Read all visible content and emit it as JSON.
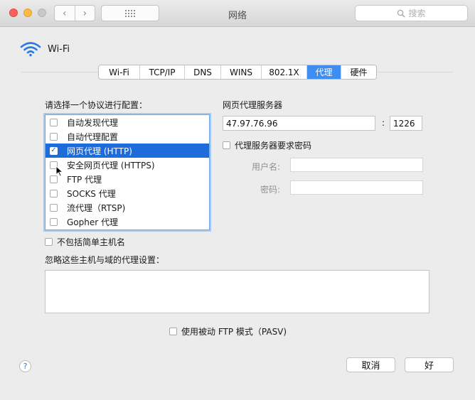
{
  "window": {
    "title": "网络"
  },
  "toolbar": {
    "search_placeholder": "搜索",
    "back": "‹",
    "forward": "›"
  },
  "interface": {
    "name": "Wi-Fi"
  },
  "tabs": [
    {
      "label": "Wi-Fi",
      "active": false
    },
    {
      "label": "TCP/IP",
      "active": false
    },
    {
      "label": "DNS",
      "active": false
    },
    {
      "label": "WINS",
      "active": false
    },
    {
      "label": "802.1X",
      "active": false
    },
    {
      "label": "代理",
      "active": true
    },
    {
      "label": "硬件",
      "active": false
    }
  ],
  "protocols": {
    "heading": "请选择一个协议进行配置：",
    "items": [
      {
        "label": "自动发现代理",
        "checked": false,
        "selected": false
      },
      {
        "label": "自动代理配置",
        "checked": false,
        "selected": false
      },
      {
        "label": "网页代理 (HTTP)",
        "checked": true,
        "selected": true
      },
      {
        "label": "安全网页代理 (HTTPS)",
        "checked": false,
        "selected": false
      },
      {
        "label": "FTP 代理",
        "checked": false,
        "selected": false
      },
      {
        "label": "SOCKS 代理",
        "checked": false,
        "selected": false
      },
      {
        "label": "流代理（RTSP)",
        "checked": false,
        "selected": false
      },
      {
        "label": "Gopher 代理",
        "checked": false,
        "selected": false
      }
    ],
    "exclude_simple": "不包括简单主机名"
  },
  "proxy_server": {
    "heading": "网页代理服务器",
    "host": "47.97.76.96",
    "separator": ":",
    "port": "1226",
    "require_password": "代理服务器要求密码",
    "username_label": "用户名:",
    "password_label": "密码:",
    "username": "",
    "password": ""
  },
  "bypass": {
    "label": "忽略这些主机与域的代理设置：",
    "value": ""
  },
  "pasv": {
    "label": "使用被动 FTP 模式（PASV)",
    "checked": false
  },
  "footer": {
    "help": "?",
    "cancel": "取消",
    "ok": "好"
  },
  "colors": {
    "accent": "#1e6cd9",
    "tab_active": "#3d8ef0",
    "focus_ring": "#a6c9f4"
  }
}
